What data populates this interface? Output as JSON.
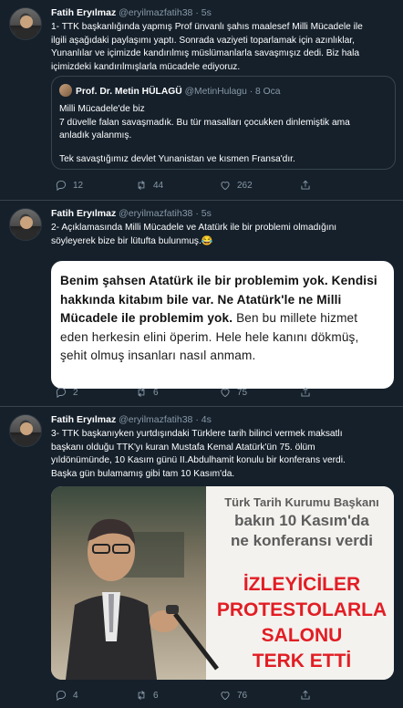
{
  "tweets": [
    {
      "author": "Fatih Eryılmaz",
      "meta": "@eryilmazfatih38 · 5s",
      "lines": [
        "1- TTK başkanlığında yapmış Prof ünvanlı şahıs maalesef Milli Mücadele ile",
        "ilgili aşağıdaki paylaşımı yaptı. Sonrada vaziyeti toparlamak için azınlıklar,",
        "Yunanlılar ve içimizde kandırılmış müslümanlarla savaşmışız dedi. Biz hala",
        "içimizdeki kandırılmışlarla mücadele ediyoruz."
      ],
      "quote": {
        "name": "Prof. Dr. Metin HÜLAGÜ",
        "meta": "@MetinHulagu · 8 Oca",
        "lines": [
          "Milli Mücadele'de biz",
          "7 düvelle falan savaşmadık. Bu tür masalları çocukken dinlemiştik ama",
          "anladık yalanmış."
        ],
        "last_line": "Tek savaştığımız devlet Yunanistan ve kısmen Fransa'dır."
      },
      "replies": "12",
      "retweets": "44",
      "likes": "262"
    },
    {
      "author": "Fatih Eryılmaz",
      "meta": "@eryilmazfatih38 · 5s",
      "lines": [
        "2- Açıklamasında Milli Mücadele ve Atatürk ile bir problemi olmadığını",
        "söyleyerek bize bir lütufta bulunmuş.😂"
      ],
      "card": {
        "bold": "Benim şahsen Atatürk ile bir problemim yok. Kendisi hakkında kitabım bile var. Ne Atatürk'le ne Milli Mücadele ile problemim yok.",
        "normal": " Ben bu millete hizmet eden herkesin elini öperim. Hele hele kanını dökmüş, şehit olmuş insanları nasıl anmam."
      },
      "replies": "2",
      "retweets": "6",
      "likes": "75"
    },
    {
      "author": "Fatih Eryılmaz",
      "meta": "@eryilmazfatih38 · 4s",
      "lines": [
        "3- TTK başkanıyken yurtdışındaki Türklere tarih bilinci vermek maksatlı",
        "başkanı olduğu TTK'yı kuran Mustafa Kemal Atatürk'ün 75. ölüm",
        "yıldönümünde, 10 Kasım günü II.Abdulhamit konulu bir konferans verdi.",
        "Başka gün bulamamış gibi tam 10 Kasım'da."
      ],
      "image_headlines": {
        "gray1": "Türk Tarih Kurumu Başkanı",
        "gray2": "bakın 10 Kasım'da",
        "gray3": "ne konferansı verdi",
        "red1": "İZLEYİCİLER",
        "red2": "PROTESTOLARLA",
        "red3": "SALONU",
        "red4": "TERK ETTİ"
      },
      "replies": "4",
      "retweets": "6",
      "likes": "76"
    }
  ]
}
